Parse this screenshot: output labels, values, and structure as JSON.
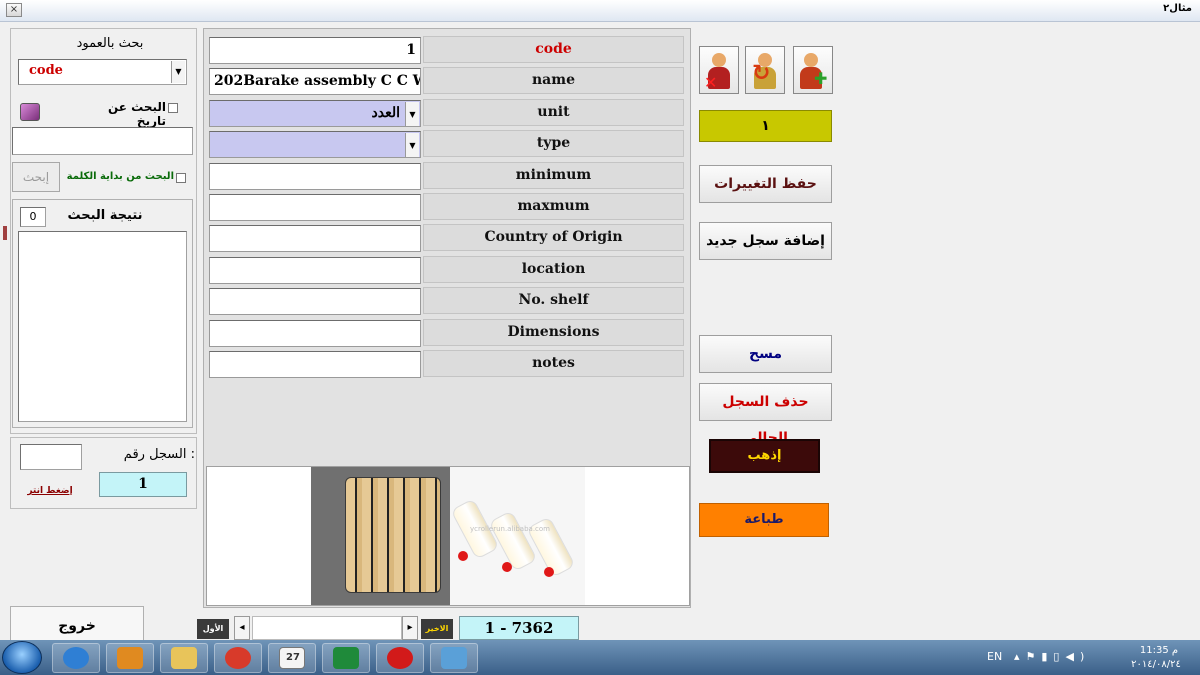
{
  "window": {
    "title": "مثال٢",
    "close_glyph": "×"
  },
  "search": {
    "by_column_label": "بحث بالعمود",
    "column_value": "code",
    "date_search_label": "البحث عن تاريخ",
    "start_of_word_label": "البحث من بداية الكلمة",
    "search_button": "إبحث",
    "results_label": "نتيجة البحث",
    "results_count": "0"
  },
  "record_nav": {
    "record_number_label": "السجل رقم :",
    "record_number": "1",
    "press_enter_label": "إضغط انتر"
  },
  "exit_button": "خروج",
  "fields": [
    {
      "label": "code",
      "value": "1",
      "type": "text"
    },
    {
      "label": "name",
      "value": "202Barake assembly C C W",
      "type": "text"
    },
    {
      "label": "unit",
      "value": "العدد",
      "type": "combo"
    },
    {
      "label": "type",
      "value": "",
      "type": "combo"
    },
    {
      "label": "minimum",
      "value": "",
      "type": "text"
    },
    {
      "label": "maxmum",
      "value": "",
      "type": "text"
    },
    {
      "label": "Country of Origin",
      "value": "",
      "type": "text"
    },
    {
      "label": "location",
      "value": "",
      "type": "text"
    },
    {
      "label": "No. shelf",
      "value": "",
      "type": "text"
    },
    {
      "label": "Dimensions",
      "value": "",
      "type": "text"
    },
    {
      "label": "notes",
      "value": "",
      "type": "text"
    }
  ],
  "image_watermark": "ycrollerun.alibaba.com",
  "footer_nav": {
    "first_label": "الأول",
    "last_label": "الاخير",
    "range": "1 - 7362",
    "prev_glyph": "◂",
    "next_glyph": "▸"
  },
  "right_panel": {
    "record_indicator": "١",
    "save_button": "حفظ التغييرات",
    "add_button": "إضافة سجل جديد",
    "clear_button": "مسح",
    "delete_button": "حذف السجل الحالي",
    "go_button": "إذهب",
    "print_button": "طباعة"
  },
  "taskbar": {
    "lang": "EN",
    "time": "11:35 م",
    "date": "٢٠١٤/٠٨/٢٤",
    "calendar_day": "27",
    "apps": [
      "start-orb",
      "internet-explorer",
      "media-player",
      "file-explorer",
      "chrome",
      "calendar",
      "excel",
      "opera",
      "paint"
    ]
  },
  "colors": {
    "combo_fill": "#c8c8f0",
    "indicator_fill": "#c8c800",
    "record_box": "#c4f4f8",
    "go_button": "#3c0a0a",
    "print_button": "#ff8000",
    "delete_text": "#cc0000",
    "clear_text": "#000080",
    "code_label": "#cc0000"
  }
}
